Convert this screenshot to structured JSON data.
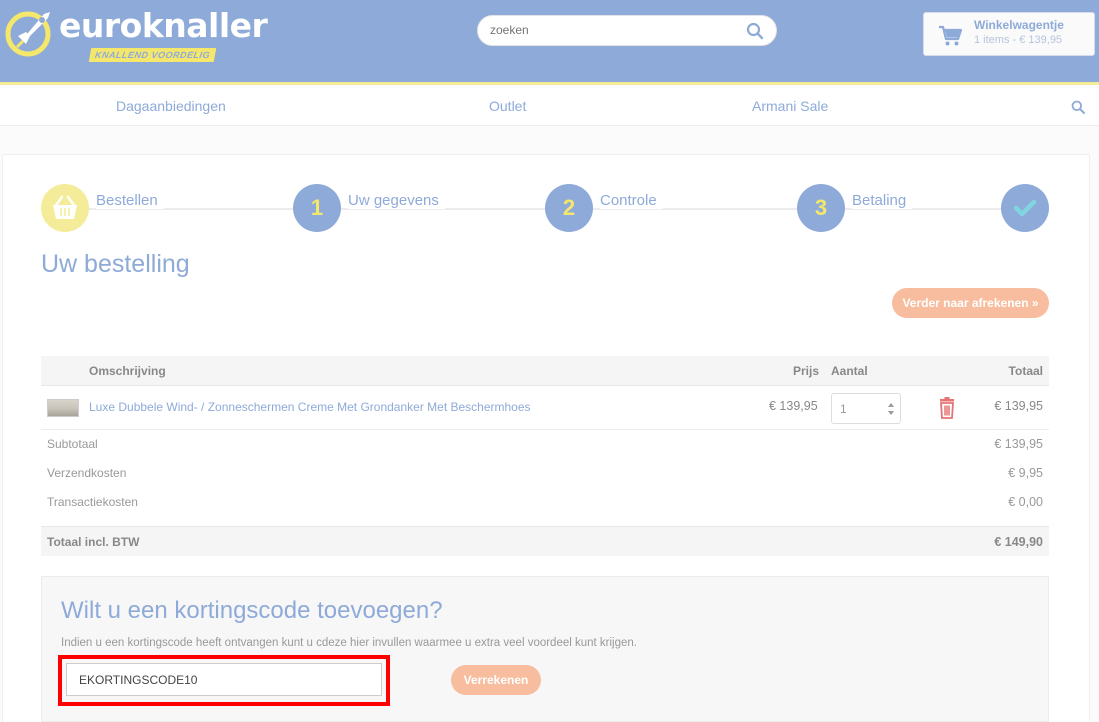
{
  "header": {
    "logo_text": "euroknaller",
    "logo_tagline": "KNALLEND VOORDELIG",
    "search_placeholder": "zoeken",
    "cart_title": "Winkelwagentje",
    "cart_summary": "1 items - € 139,95"
  },
  "nav": {
    "items": [
      "Dagaanbiedingen",
      "Outlet",
      "Armani Sale"
    ]
  },
  "steps": [
    {
      "number": "",
      "label": "Bestellen"
    },
    {
      "number": "1",
      "label": "Uw gegevens"
    },
    {
      "number": "2",
      "label": "Controle"
    },
    {
      "number": "3",
      "label": "Betaling"
    },
    {
      "number": "",
      "label": ""
    }
  ],
  "order": {
    "title": "Uw bestelling",
    "proceed_label": "Verder naar afrekenen »",
    "columns": {
      "description": "Omschrijving",
      "price": "Prijs",
      "quantity": "Aantal",
      "total": "Totaal"
    },
    "items": [
      {
        "name": "Luxe Dubbele Wind- / Zonneschermen Creme Met Grondanker Met Beschermhoes",
        "price": "€ 139,95",
        "quantity": "1",
        "total": "€ 139,95"
      }
    ],
    "summary": [
      {
        "label": "Subtotaal",
        "value": "€ 139,95"
      },
      {
        "label": "Verzendkosten",
        "value": "€ 9,95"
      },
      {
        "label": "Transactiekosten",
        "value": "€ 0,00"
      }
    ],
    "grand_total_label": "Totaal incl. BTW",
    "grand_total_value": "€ 149,90"
  },
  "coupon": {
    "title": "Wilt u een kortingscode toevoegen?",
    "description": "Indien u een kortingscode heeft ontvangen kunt u cdeze hier invullen waarmee u extra veel voordeel kunt krijgen.",
    "code_value": "EKORTINGSCODE10",
    "apply_label": "Verrekenen"
  },
  "colors": {
    "brand_blue": "#8eaad8",
    "brand_yellow": "#f5e76b",
    "accent_orange": "#f7bd9e",
    "delete_red": "#e57373",
    "highlight_red": "#ff0000"
  }
}
